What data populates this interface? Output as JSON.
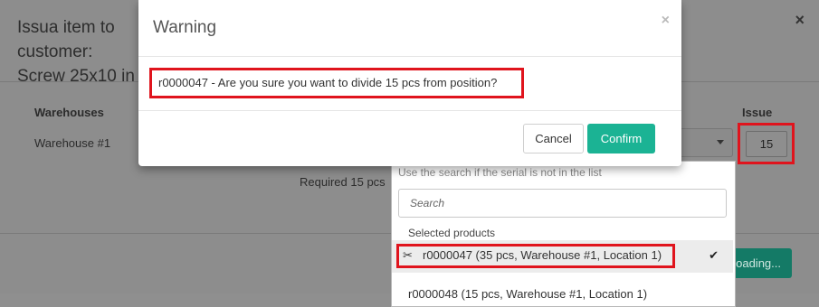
{
  "issue_modal": {
    "title": "Issua item to customer: Screw 25x10 in",
    "close_icon": "×",
    "warehouses_header": "Warehouses",
    "warehouse_name": "Warehouse #1",
    "issue_header": "Issue",
    "issue_value": "15",
    "required_text": "Required 15 pcs",
    "loading_label": "Loading..."
  },
  "serial_dropdown": {
    "hint": "Use the search if the serial is not in the list",
    "search_placeholder": "Search",
    "group_label": "Selected products",
    "selected_icon": "✂",
    "selected_item": "r0000047  (35 pcs, Warehouse #1, Location 1)",
    "selected_check": "✔",
    "next_item": "r0000048  (15 pcs, Warehouse #1, Location 1)"
  },
  "warning_dialog": {
    "title": "Warning",
    "close_icon": "×",
    "message": "r0000047 - Are you sure you want to divide 15 pcs from position?",
    "cancel_label": "Cancel",
    "confirm_label": "Confirm"
  },
  "colors": {
    "confirm": "#1bb394",
    "highlight": "#e0141d"
  }
}
